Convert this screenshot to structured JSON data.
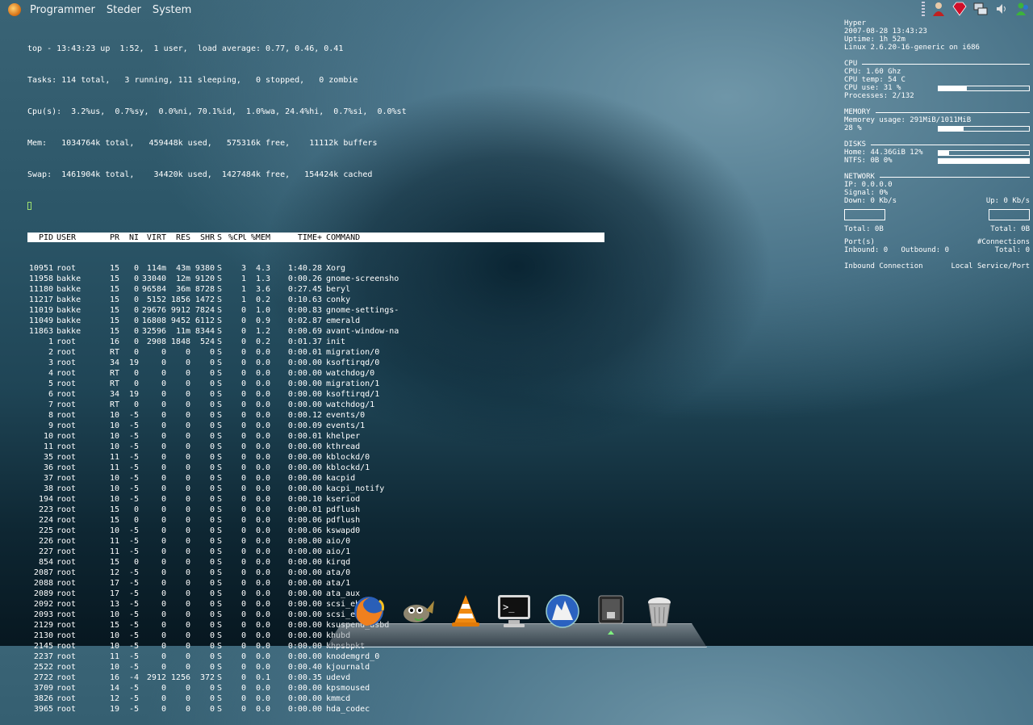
{
  "panel": {
    "menus": [
      "Programmer",
      "Steder",
      "System"
    ],
    "tray_icons": [
      "panel-grip-icon",
      "user-switcher-icon",
      "ruby-gem-icon",
      "network-icon",
      "volume-icon",
      "messenger-buddy-icon"
    ]
  },
  "top": {
    "summary": [
      "top - 13:43:23 up  1:52,  1 user,  load average: 0.77, 0.46, 0.41",
      "Tasks: 114 total,   3 running, 111 sleeping,   0 stopped,   0 zombie",
      "Cpu(s):  3.2%us,  0.7%sy,  0.0%ni, 70.1%id,  1.0%wa, 24.4%hi,  0.7%si,  0.0%st",
      "Mem:   1034764k total,   459448k used,   575316k free,    11112k buffers",
      "Swap:  1461904k total,    34420k used,  1427484k free,   154424k cached"
    ],
    "columns": [
      "PID",
      "USER",
      "PR",
      "NI",
      "VIRT",
      "RES",
      "SHR",
      "S",
      "%CPU",
      "%MEM",
      "TIME+",
      "COMMAND"
    ],
    "processes": [
      [
        "10951",
        "root",
        "15",
        "0",
        "114m",
        "43m",
        "9380",
        "S",
        "3",
        "4.3",
        "1:40.28",
        "Xorg"
      ],
      [
        "11958",
        "bakke",
        "15",
        "0",
        "33040",
        "12m",
        "9120",
        "S",
        "1",
        "1.3",
        "0:00.26",
        "gnome-screensho"
      ],
      [
        "11180",
        "bakke",
        "15",
        "0",
        "96584",
        "36m",
        "8728",
        "S",
        "1",
        "3.6",
        "0:27.45",
        "beryl"
      ],
      [
        "11217",
        "bakke",
        "15",
        "0",
        "5152",
        "1856",
        "1472",
        "S",
        "1",
        "0.2",
        "0:10.63",
        "conky"
      ],
      [
        "11019",
        "bakke",
        "15",
        "0",
        "29676",
        "9912",
        "7824",
        "S",
        "0",
        "1.0",
        "0:00.83",
        "gnome-settings-"
      ],
      [
        "11049",
        "bakke",
        "15",
        "0",
        "16808",
        "9452",
        "6112",
        "S",
        "0",
        "0.9",
        "0:02.87",
        "emerald"
      ],
      [
        "11863",
        "bakke",
        "15",
        "0",
        "32596",
        "11m",
        "8344",
        "S",
        "0",
        "1.2",
        "0:00.69",
        "avant-window-na"
      ],
      [
        "1",
        "root",
        "16",
        "0",
        "2908",
        "1848",
        "524",
        "S",
        "0",
        "0.2",
        "0:01.37",
        "init"
      ],
      [
        "2",
        "root",
        "RT",
        "0",
        "0",
        "0",
        "0",
        "S",
        "0",
        "0.0",
        "0:00.01",
        "migration/0"
      ],
      [
        "3",
        "root",
        "34",
        "19",
        "0",
        "0",
        "0",
        "S",
        "0",
        "0.0",
        "0:00.00",
        "ksoftirqd/0"
      ],
      [
        "4",
        "root",
        "RT",
        "0",
        "0",
        "0",
        "0",
        "S",
        "0",
        "0.0",
        "0:00.00",
        "watchdog/0"
      ],
      [
        "5",
        "root",
        "RT",
        "0",
        "0",
        "0",
        "0",
        "S",
        "0",
        "0.0",
        "0:00.00",
        "migration/1"
      ],
      [
        "6",
        "root",
        "34",
        "19",
        "0",
        "0",
        "0",
        "S",
        "0",
        "0.0",
        "0:00.00",
        "ksoftirqd/1"
      ],
      [
        "7",
        "root",
        "RT",
        "0",
        "0",
        "0",
        "0",
        "S",
        "0",
        "0.0",
        "0:00.00",
        "watchdog/1"
      ],
      [
        "8",
        "root",
        "10",
        "-5",
        "0",
        "0",
        "0",
        "S",
        "0",
        "0.0",
        "0:00.12",
        "events/0"
      ],
      [
        "9",
        "root",
        "10",
        "-5",
        "0",
        "0",
        "0",
        "S",
        "0",
        "0.0",
        "0:00.09",
        "events/1"
      ],
      [
        "10",
        "root",
        "10",
        "-5",
        "0",
        "0",
        "0",
        "S",
        "0",
        "0.0",
        "0:00.01",
        "khelper"
      ],
      [
        "11",
        "root",
        "10",
        "-5",
        "0",
        "0",
        "0",
        "S",
        "0",
        "0.0",
        "0:00.00",
        "kthread"
      ],
      [
        "35",
        "root",
        "11",
        "-5",
        "0",
        "0",
        "0",
        "S",
        "0",
        "0.0",
        "0:00.00",
        "kblockd/0"
      ],
      [
        "36",
        "root",
        "11",
        "-5",
        "0",
        "0",
        "0",
        "S",
        "0",
        "0.0",
        "0:00.00",
        "kblockd/1"
      ],
      [
        "37",
        "root",
        "10",
        "-5",
        "0",
        "0",
        "0",
        "S",
        "0",
        "0.0",
        "0:00.00",
        "kacpid"
      ],
      [
        "38",
        "root",
        "10",
        "-5",
        "0",
        "0",
        "0",
        "S",
        "0",
        "0.0",
        "0:00.00",
        "kacpi_notify"
      ],
      [
        "194",
        "root",
        "10",
        "-5",
        "0",
        "0",
        "0",
        "S",
        "0",
        "0.0",
        "0:00.10",
        "kseriod"
      ],
      [
        "223",
        "root",
        "15",
        "0",
        "0",
        "0",
        "0",
        "S",
        "0",
        "0.0",
        "0:00.01",
        "pdflush"
      ],
      [
        "224",
        "root",
        "15",
        "0",
        "0",
        "0",
        "0",
        "S",
        "0",
        "0.0",
        "0:00.06",
        "pdflush"
      ],
      [
        "225",
        "root",
        "10",
        "-5",
        "0",
        "0",
        "0",
        "S",
        "0",
        "0.0",
        "0:00.06",
        "kswapd0"
      ],
      [
        "226",
        "root",
        "11",
        "-5",
        "0",
        "0",
        "0",
        "S",
        "0",
        "0.0",
        "0:00.00",
        "aio/0"
      ],
      [
        "227",
        "root",
        "11",
        "-5",
        "0",
        "0",
        "0",
        "S",
        "0",
        "0.0",
        "0:00.00",
        "aio/1"
      ],
      [
        "854",
        "root",
        "15",
        "0",
        "0",
        "0",
        "0",
        "S",
        "0",
        "0.0",
        "0:00.00",
        "kirqd"
      ],
      [
        "2087",
        "root",
        "12",
        "-5",
        "0",
        "0",
        "0",
        "S",
        "0",
        "0.0",
        "0:00.00",
        "ata/0"
      ],
      [
        "2088",
        "root",
        "17",
        "-5",
        "0",
        "0",
        "0",
        "S",
        "0",
        "0.0",
        "0:00.00",
        "ata/1"
      ],
      [
        "2089",
        "root",
        "17",
        "-5",
        "0",
        "0",
        "0",
        "S",
        "0",
        "0.0",
        "0:00.00",
        "ata_aux"
      ],
      [
        "2092",
        "root",
        "13",
        "-5",
        "0",
        "0",
        "0",
        "S",
        "0",
        "0.0",
        "0:00.00",
        "scsi_eh_0"
      ],
      [
        "2093",
        "root",
        "10",
        "-5",
        "0",
        "0",
        "0",
        "S",
        "0",
        "0.0",
        "0:00.00",
        "scsi_eh_1"
      ],
      [
        "2129",
        "root",
        "15",
        "-5",
        "0",
        "0",
        "0",
        "S",
        "0",
        "0.0",
        "0:00.00",
        "ksuspend_usbd"
      ],
      [
        "2130",
        "root",
        "10",
        "-5",
        "0",
        "0",
        "0",
        "S",
        "0",
        "0.0",
        "0:00.00",
        "khubd"
      ],
      [
        "2145",
        "root",
        "10",
        "-5",
        "0",
        "0",
        "0",
        "S",
        "0",
        "0.0",
        "0:00.00",
        "khpsbpkt"
      ],
      [
        "2237",
        "root",
        "11",
        "-5",
        "0",
        "0",
        "0",
        "S",
        "0",
        "0.0",
        "0:00.00",
        "knodemgrd_0"
      ],
      [
        "2522",
        "root",
        "10",
        "-5",
        "0",
        "0",
        "0",
        "S",
        "0",
        "0.0",
        "0:00.40",
        "kjournald"
      ],
      [
        "2722",
        "root",
        "16",
        "-4",
        "2912",
        "1256",
        "372",
        "S",
        "0",
        "0.1",
        "0:00.35",
        "udevd"
      ],
      [
        "3709",
        "root",
        "14",
        "-5",
        "0",
        "0",
        "0",
        "S",
        "0",
        "0.0",
        "0:00.00",
        "kpsmoused"
      ],
      [
        "3826",
        "root",
        "12",
        "-5",
        "0",
        "0",
        "0",
        "S",
        "0",
        "0.0",
        "0:00.00",
        "kmmcd"
      ],
      [
        "3965",
        "root",
        "19",
        "-5",
        "0",
        "0",
        "0",
        "S",
        "0",
        "0.0",
        "0:00.00",
        "hda_codec"
      ]
    ]
  },
  "conky": {
    "host": "Hyper",
    "datetime": "2007-08-28 13:43:23",
    "uptime": "Uptime: 1h 52m",
    "kernel": "Linux 2.6.20-16-generic on i686",
    "cpu": {
      "section": "CPU",
      "freq": "CPU: 1.60 Ghz",
      "temp": "CPU temp: 54 C",
      "use": "CPU use: 31 %",
      "use_fraction": 0.31,
      "processes": "Processes: 2/132"
    },
    "memory": {
      "section": "MEMORY",
      "usage": "Memorey usage: 291MiB/1011MiB",
      "percent": "28 %",
      "use_fraction": 0.28
    },
    "disks": {
      "section": "DISKS",
      "home": "Home: 44.36GiB 12%",
      "home_fraction": 0.12,
      "ntfs": "NTFS: 0B 0%",
      "ntfs_fraction": 1.0
    },
    "network": {
      "section": "NETWORK",
      "ip": "IP: 0.0.0.0",
      "signal": "Signal: 0%",
      "down": "Down: 0 Kb/s",
      "up": "Up: 0 Kb/s",
      "total_down": "Total: 0B",
      "total_up": "Total: 0B",
      "ports": "Port(s)",
      "connections": "#Connections",
      "inbound": "Inbound: 0",
      "outbound": "Outbound: 0",
      "total": "Total: 0",
      "inbound_conn": "Inbound Connection",
      "local_service": "Local Service/Port"
    }
  },
  "dock": {
    "items": [
      "firefox-icon",
      "gimp-icon",
      "vlc-icon",
      "terminal-icon",
      "linux-mascot-icon",
      "monitor-settings-icon",
      "trash-icon"
    ],
    "running_index": 5
  }
}
